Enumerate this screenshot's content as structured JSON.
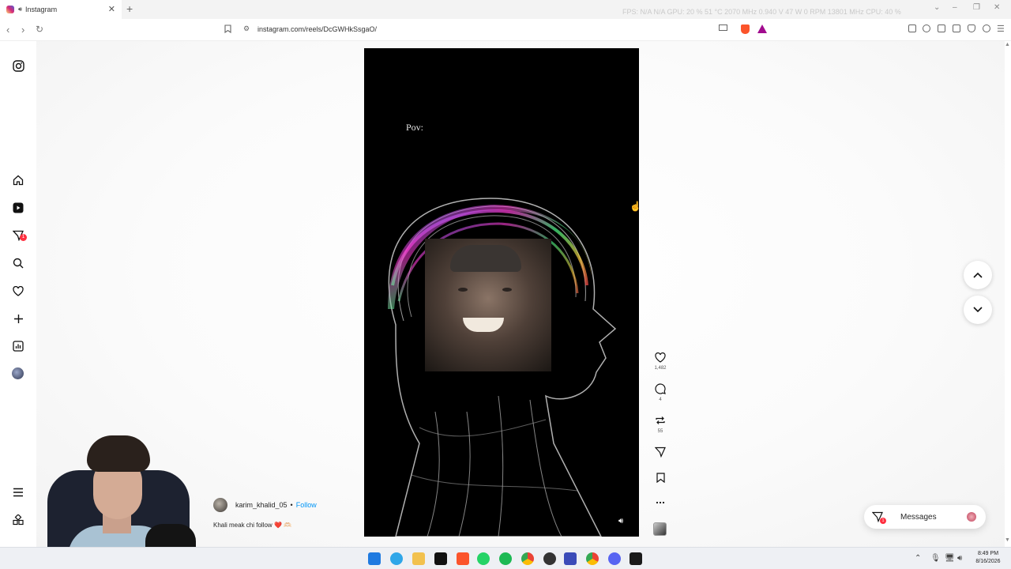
{
  "browser": {
    "tab_title": "Instagram",
    "tab_audio_icon": "speaker-icon",
    "new_tab_symbol": "+",
    "url": "instagram.com/reels/DcGWHkSsgaO/",
    "overlay_stats": "FPS: N/A  N/A     GPU: 20 %  51 °C  2070 MHz  0.940 V  47 W  0 RPM  13801 MHz      CPU: 40 %"
  },
  "sidebar": {
    "items": [
      {
        "name": "instagram-logo-icon"
      },
      {
        "name": "home-icon"
      },
      {
        "name": "reels-icon"
      },
      {
        "name": "messages-icon",
        "badge": "1"
      },
      {
        "name": "search-icon"
      },
      {
        "name": "notifications-heart-icon"
      },
      {
        "name": "create-plus-icon"
      },
      {
        "name": "dashboard-icon"
      },
      {
        "name": "profile-avatar"
      },
      {
        "name": "menu-icon"
      },
      {
        "name": "also-from-meta-icon"
      }
    ]
  },
  "reel": {
    "overlay_text": "Pov:",
    "likes": "1,482",
    "comments": "4",
    "reposts": "55",
    "username": "karim_khalid_05",
    "separator": "•",
    "follow_label": "Follow",
    "caption": "Khali meak chi follow",
    "caption_emoji": "❤️ 🫶🏻"
  },
  "messages_pill": {
    "label": "Messages",
    "badge": "1"
  },
  "taskbar": {
    "time": "8:49 PM",
    "date": "8/16/2026"
  },
  "colors": {
    "follow_blue": "#0095f6",
    "badge_red": "#ff3040",
    "video_bg": "#000000"
  }
}
